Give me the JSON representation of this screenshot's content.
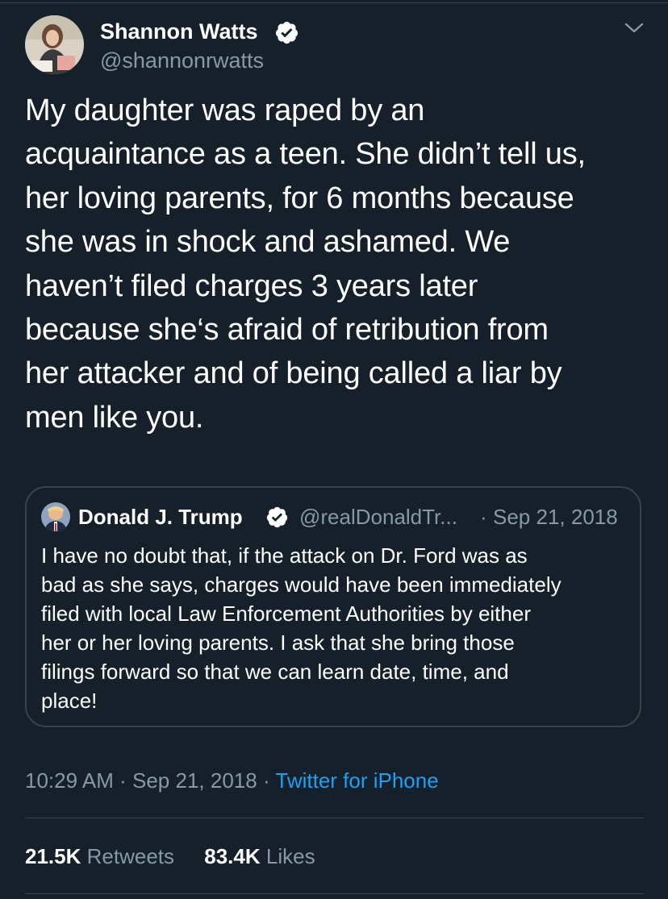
{
  "tweet": {
    "author_name": "Shannon Watts",
    "author_handle": "@shannonrwatts",
    "text": "My daughter was raped by an\nacquaintance as a teen. She didn’t tell us,\nher loving parents, for 6 months because\nshe was in shock and ashamed. We\nhaven’t filed charges 3 years later\nbecause she‘s afraid of retribution from\nher attacker and of being called a liar by\nmen like you.",
    "time": "10:29 AM",
    "date": "Sep 21, 2018",
    "source": "Twitter for iPhone",
    "retweets": "21.5K",
    "retweets_label": "Retweets",
    "likes": "83.4K",
    "likes_label": "Likes"
  },
  "quoted_tweet": {
    "author_name": "Donald J. Trump",
    "author_handle": "@realDonaldTr...",
    "date": "Sep 21, 2018",
    "text": "I have no doubt that, if the attack on Dr. Ford was as\nbad as she says, charges would have been immediately\nfiled with local Law Enforcement Authorities by either\nher or her loving parents. I ask that she bring those\nfilings forward so that we can learn  date, time, and\nplace!"
  },
  "separator": "·",
  "icons": {
    "verified": "verified-badge-icon",
    "menu": "chevron-down-icon"
  },
  "colors": {
    "background": "#15202b",
    "text_primary": "#ffffff",
    "text_secondary": "#8899a6",
    "link": "#1da1f2",
    "border": "#38444d"
  }
}
